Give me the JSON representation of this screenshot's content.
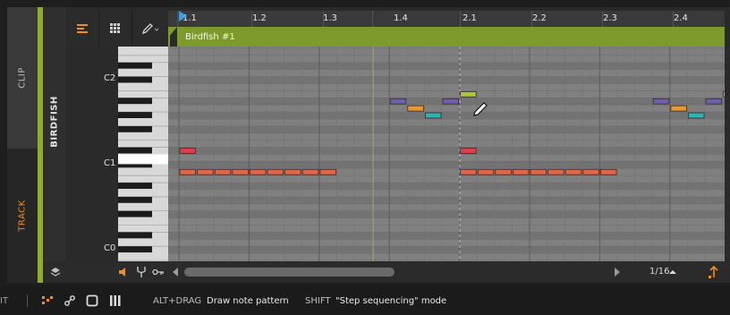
{
  "tabs": {
    "clip": "CLIP",
    "track": "TRACK"
  },
  "track_name": "BIRDFISH",
  "ruler": {
    "labels": [
      "1.1",
      "1.2",
      "1.3",
      "1.4",
      "2.1",
      "2.2",
      "2.3",
      "2.4"
    ]
  },
  "clip": {
    "name": "Birdfish #1"
  },
  "keyboard": {
    "labels": [
      "C2",
      "C1",
      "C0"
    ]
  },
  "footer": {
    "grid_resolution": "1/16"
  },
  "status": {
    "left_cut": "IT",
    "hint1_key": "ALT+DRAG",
    "hint1_text": "Draw note pattern",
    "hint2_key": "SHIFT",
    "hint2_text": "\"Step sequencing\" mode"
  },
  "colors": {
    "accent": "#f08a24",
    "clip_green": "#8fad2c",
    "note_orange": "#e0664a",
    "note_red": "#d8404c",
    "note_purple": "#6a5fb0",
    "note_amber": "#e8962e",
    "note_teal": "#2fb3b0",
    "note_lime": "#a8c83a"
  },
  "notes": [
    {
      "pitch": "D#1",
      "start": 1,
      "length": 1,
      "color": "note_red"
    },
    {
      "pitch": "C1",
      "start": 1,
      "length": 1,
      "color": "note_orange"
    },
    {
      "pitch": "C1",
      "start": 2,
      "length": 1,
      "color": "note_orange"
    },
    {
      "pitch": "C1",
      "start": 3,
      "length": 1,
      "color": "note_orange"
    },
    {
      "pitch": "C1",
      "start": 4,
      "length": 1,
      "color": "note_orange"
    },
    {
      "pitch": "C1",
      "start": 5,
      "length": 1,
      "color": "note_orange"
    },
    {
      "pitch": "C1",
      "start": 6,
      "length": 1,
      "color": "note_orange"
    },
    {
      "pitch": "C1",
      "start": 7,
      "length": 1,
      "color": "note_orange"
    },
    {
      "pitch": "C1",
      "start": 8,
      "length": 1,
      "color": "note_orange"
    },
    {
      "pitch": "C1",
      "start": 9,
      "length": 1,
      "color": "note_orange"
    },
    {
      "pitch": "A#1",
      "start": 13,
      "length": 1,
      "color": "note_purple"
    },
    {
      "pitch": "A1",
      "start": 14,
      "length": 1,
      "color": "note_amber"
    },
    {
      "pitch": "G#1",
      "start": 15,
      "length": 1,
      "color": "note_teal"
    },
    {
      "pitch": "A#1",
      "start": 16,
      "length": 1,
      "color": "note_purple"
    },
    {
      "pitch": "B1",
      "start": 17,
      "length": 1,
      "color": "note_lime"
    },
    {
      "pitch": "D#1",
      "start": 17,
      "length": 1,
      "color": "note_red"
    },
    {
      "pitch": "C1",
      "start": 17,
      "length": 1,
      "color": "note_orange"
    },
    {
      "pitch": "C1",
      "start": 18,
      "length": 1,
      "color": "note_orange"
    },
    {
      "pitch": "C1",
      "start": 19,
      "length": 1,
      "color": "note_orange"
    },
    {
      "pitch": "C1",
      "start": 20,
      "length": 1,
      "color": "note_orange"
    },
    {
      "pitch": "C1",
      "start": 21,
      "length": 1,
      "color": "note_orange"
    },
    {
      "pitch": "C1",
      "start": 22,
      "length": 1,
      "color": "note_orange"
    },
    {
      "pitch": "C1",
      "start": 23,
      "length": 1,
      "color": "note_orange"
    },
    {
      "pitch": "C1",
      "start": 24,
      "length": 1,
      "color": "note_orange"
    },
    {
      "pitch": "C1",
      "start": 25,
      "length": 1,
      "color": "note_orange"
    },
    {
      "pitch": "A#1",
      "start": 28,
      "length": 1,
      "color": "note_purple"
    },
    {
      "pitch": "A1",
      "start": 29,
      "length": 1,
      "color": "note_amber"
    },
    {
      "pitch": "G#1",
      "start": 30,
      "length": 1,
      "color": "note_teal"
    },
    {
      "pitch": "A#1",
      "start": 31,
      "length": 1,
      "color": "note_purple"
    },
    {
      "pitch": "B1",
      "start": 32,
      "length": 1,
      "color": "note_lime"
    }
  ]
}
